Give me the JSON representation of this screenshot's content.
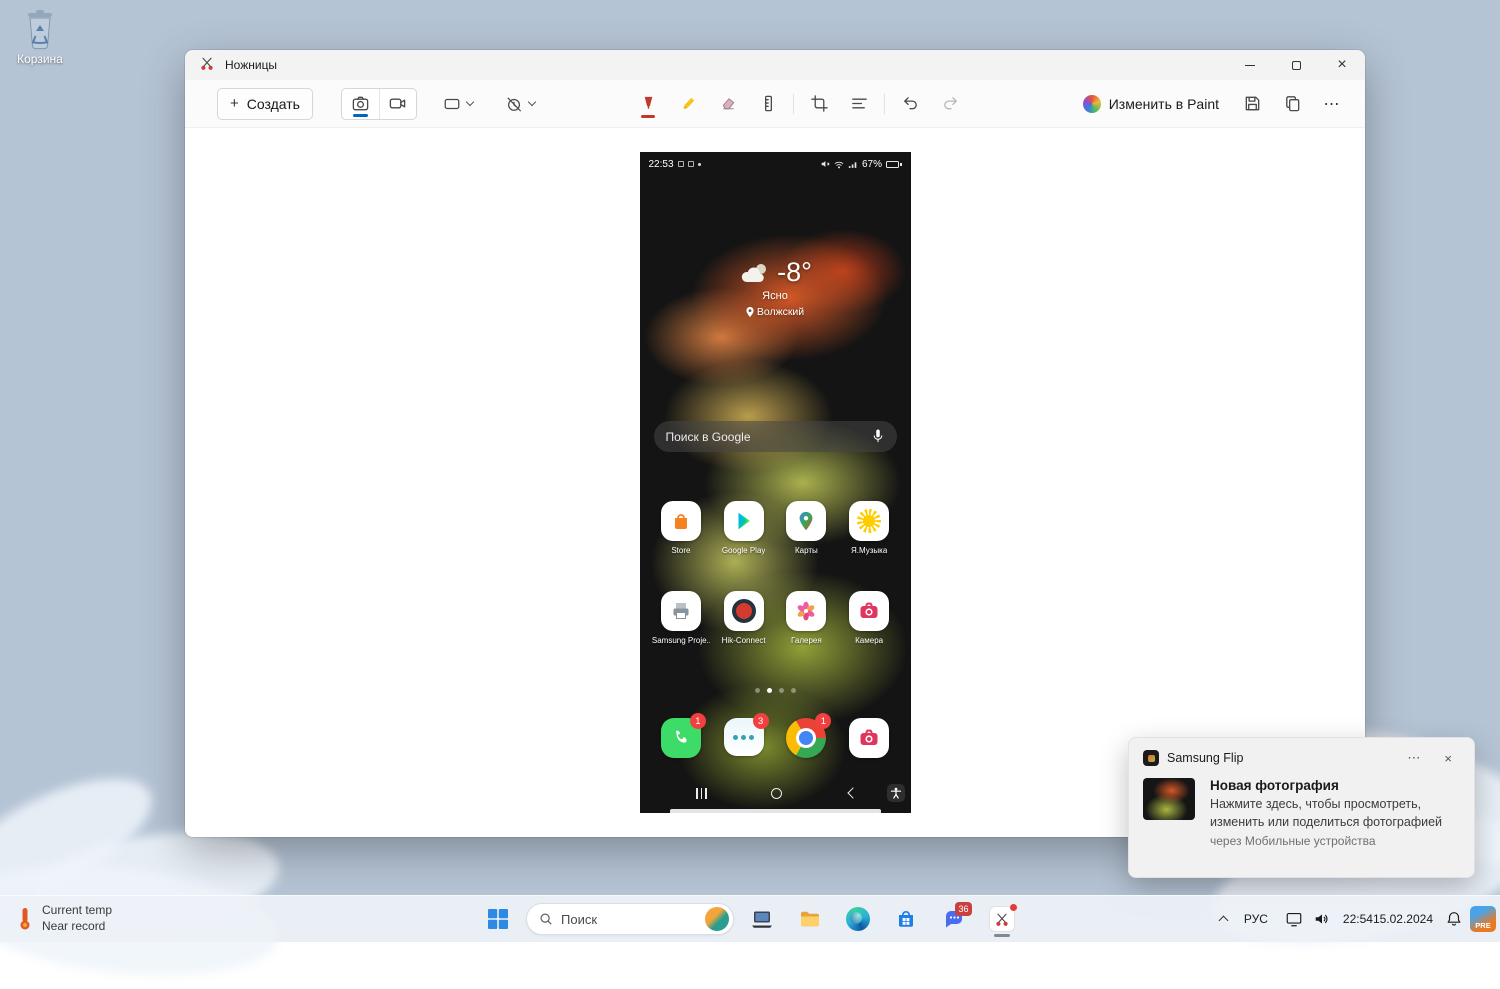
{
  "desktop": {
    "recycle_bin_label": "Корзина"
  },
  "window": {
    "title": "Ножницы",
    "controls": {
      "close": "×"
    },
    "toolbar": {
      "new_plus": "+",
      "new_button": "Создать",
      "edit_in_paint": "Изменить в Paint",
      "more": "⋯"
    }
  },
  "phone": {
    "status": {
      "time": "22:53",
      "battery_pct": "67%"
    },
    "weather": {
      "temp": "-8°",
      "condition": "Ясно",
      "location": "Волжский"
    },
    "search_placeholder": "Поиск в Google",
    "app_rows": [
      [
        {
          "label": "Store"
        },
        {
          "label": "Google Play"
        },
        {
          "label": "Карты"
        },
        {
          "label": "Я.Музыка"
        }
      ],
      [
        {
          "label": "Samsung Proje..."
        },
        {
          "label": "Hik-Connect"
        },
        {
          "label": "Галерея"
        },
        {
          "label": "Камера"
        }
      ]
    ],
    "dock": {
      "phone_badge": "1",
      "messages_badge": "3",
      "chrome_badge": "1"
    }
  },
  "toast": {
    "app_name": "Samsung Flip",
    "more": "⋯",
    "close": "×",
    "title": "Новая фотография",
    "body": "Нажмите здесь, чтобы просмотреть, изменить или поделиться фотографией",
    "footer": "через Мобильные устройства"
  },
  "taskbar": {
    "widget": {
      "line1": "Current temp",
      "line2": "Near record"
    },
    "search_placeholder": "Поиск",
    "chat_badge": "36",
    "tray": {
      "language": "РУС",
      "time": "22:54",
      "date": "15.02.2024",
      "insider_badge": "PRE"
    }
  }
}
